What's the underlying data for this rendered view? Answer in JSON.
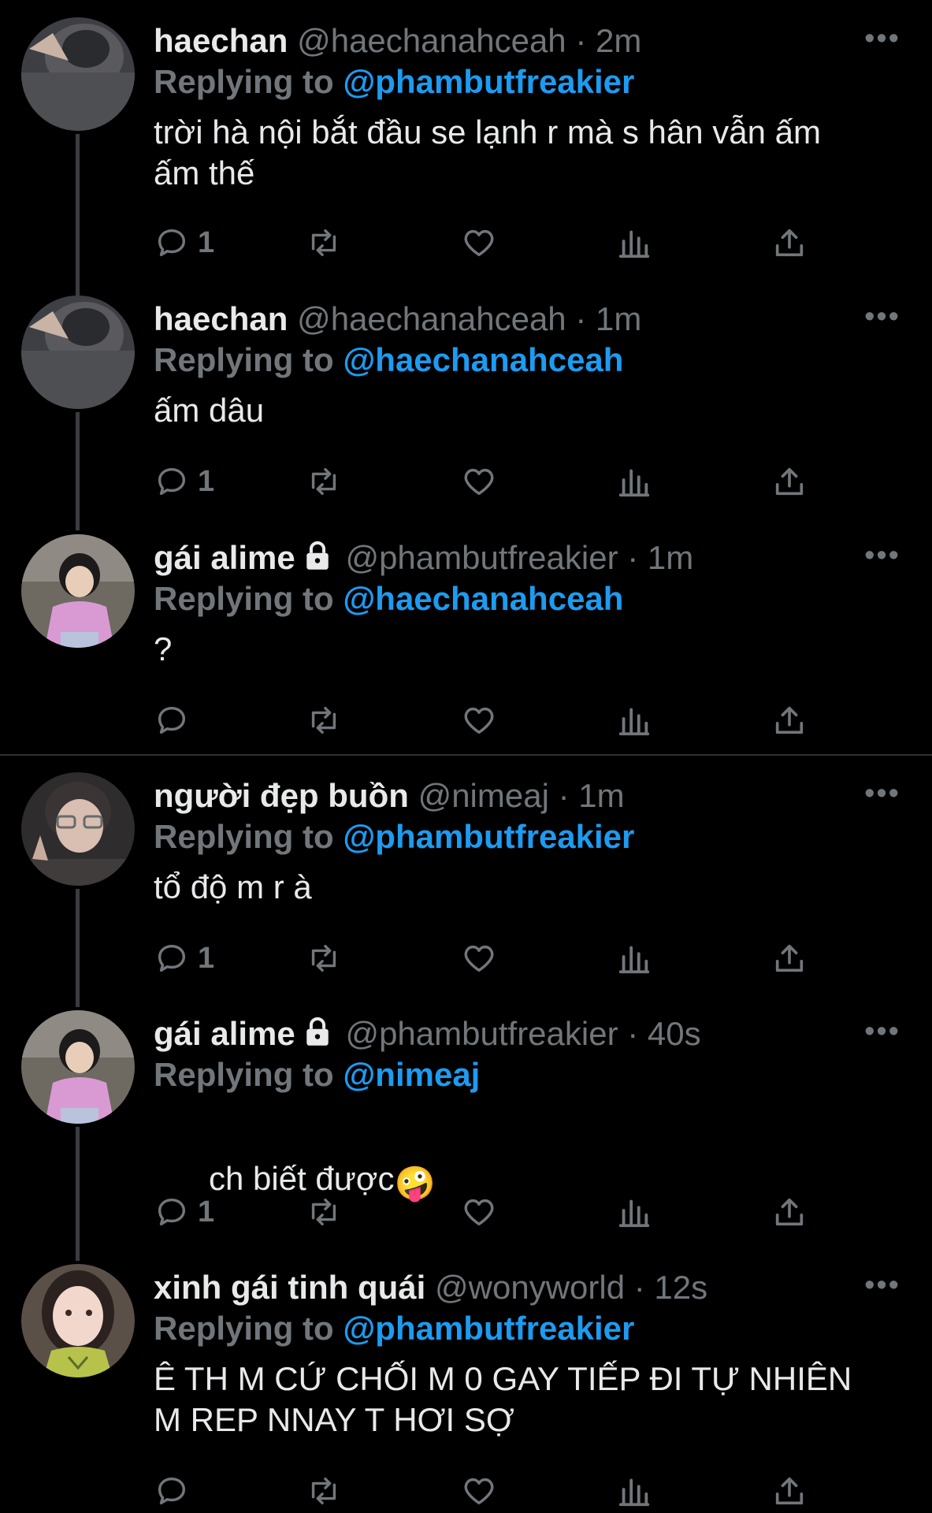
{
  "colors": {
    "background": "#000000",
    "text": "#e7e9ea",
    "muted": "#71767b",
    "link": "#1d9bf0",
    "divider": "#2f3336"
  },
  "reply_label": "Replying to",
  "more_label": "•••",
  "tweets": [
    {
      "name": "haechan",
      "handle": "@haechanahceah",
      "dot": "·",
      "time": "2m",
      "locked": false,
      "reply_to": "@phambutfreakier",
      "text": "trời hà nội bắt đầu se lạnh r mà s hân vẫn ấm\nấm thế",
      "replies": "1"
    },
    {
      "name": "haechan",
      "handle": "@haechanahceah",
      "dot": "·",
      "time": "1m",
      "locked": false,
      "reply_to": "@haechanahceah",
      "text": "ấm dâu",
      "replies": "1"
    },
    {
      "name": "gái alime",
      "handle": "@phambutfreakier",
      "dot": "·",
      "time": "1m",
      "locked": true,
      "reply_to": "@haechanahceah",
      "text": "?",
      "replies": ""
    },
    {
      "name": "người đẹp buồn",
      "handle": "@nimeaj",
      "dot": "·",
      "time": "1m",
      "locked": false,
      "reply_to": "@phambutfreakier",
      "text": "tổ độ m r à",
      "replies": "1"
    },
    {
      "name": "gái alime",
      "handle": "@phambutfreakier",
      "dot": "·",
      "time": "40s",
      "locked": true,
      "reply_to": "@nimeaj",
      "text": "ch biết được",
      "emoji": "🤪",
      "replies": "1"
    },
    {
      "name": "xinh gái tinh quái",
      "handle": "@wonyworld",
      "dot": "·",
      "time": "12s",
      "locked": false,
      "reply_to": "@phambutfreakier",
      "text": "Ê TH M CỨ CHỐI M 0 GAY TIẾP ĐI TỰ NHIÊN\nM REP NNAY T HƠI SỢ",
      "replies": ""
    }
  ]
}
